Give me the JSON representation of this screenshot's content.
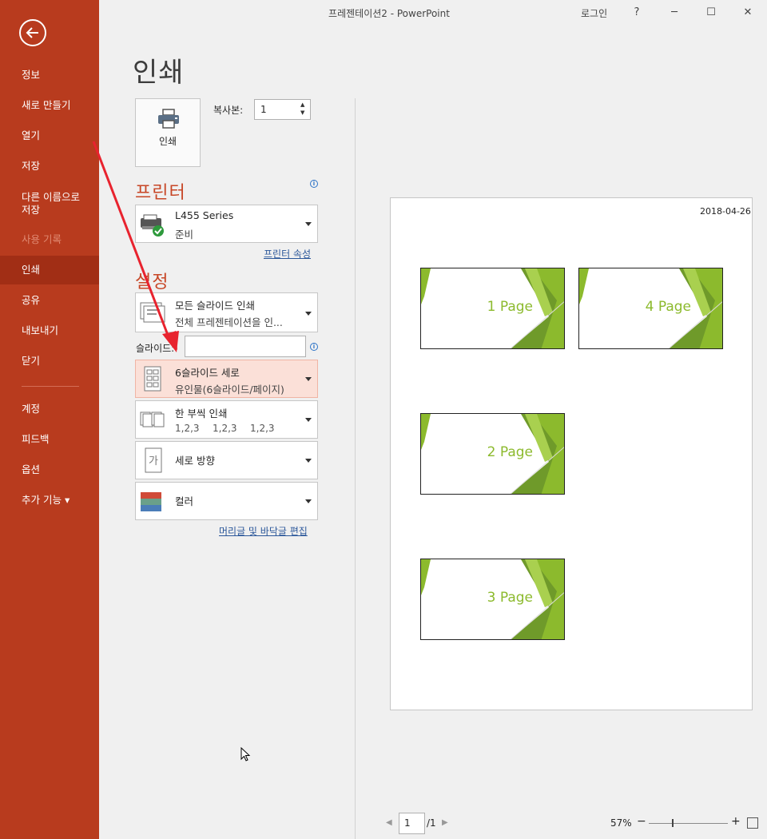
{
  "window": {
    "title": "프레젠테이션2  -  PowerPoint",
    "login": "로그인",
    "help": "?",
    "minimize": "─",
    "maximize": "☐",
    "close": "✕"
  },
  "sidebar": {
    "items": [
      {
        "label": "정보"
      },
      {
        "label": "새로 만들기"
      },
      {
        "label": "열기"
      },
      {
        "label": "저장"
      },
      {
        "label": "다른 이름으로 저장"
      },
      {
        "label": "사용 기록",
        "disabled": true
      },
      {
        "label": "인쇄",
        "active": true
      },
      {
        "label": "공유"
      },
      {
        "label": "내보내기"
      },
      {
        "label": "닫기"
      },
      {
        "label": "계정"
      },
      {
        "label": "피드백"
      },
      {
        "label": "옵션"
      },
      {
        "label": "추가 기능 ▾"
      }
    ]
  },
  "main": {
    "title": "인쇄",
    "print_button": "인쇄",
    "copies_label": "복사본:",
    "copies_value": "1",
    "printer_heading": "프린터",
    "printer": {
      "name": "L455 Series",
      "status": "준비"
    },
    "printer_properties": "프린터 속성",
    "settings_heading": "설정",
    "print_range": {
      "line1": "모든 슬라이드 인쇄",
      "line2": "전체 프레젠테이션을 인..."
    },
    "slides_label": "슬라이드:",
    "slides_value": "",
    "layout": {
      "line1": "6슬라이드 세로",
      "line2": "유인물(6슬라이드/페이지)"
    },
    "collation": {
      "line1": "한 부씩 인쇄",
      "cols": [
        "1,2,3",
        "1,2,3",
        "1,2,3"
      ]
    },
    "orientation": {
      "line1": "세로 방향"
    },
    "color": {
      "line1": "컬러"
    },
    "header_footer": "머리글 및 바닥글 편집"
  },
  "preview": {
    "date": "2018-04-26",
    "slides": [
      "1 Page",
      "2 Page",
      "3 Page",
      "4 Page"
    ],
    "accent_color": "#8cba2d"
  },
  "bottom_bar": {
    "current_page": "1",
    "total_pages": "/1",
    "zoom": "57%",
    "zoom_out": "−",
    "zoom_in": "+"
  }
}
